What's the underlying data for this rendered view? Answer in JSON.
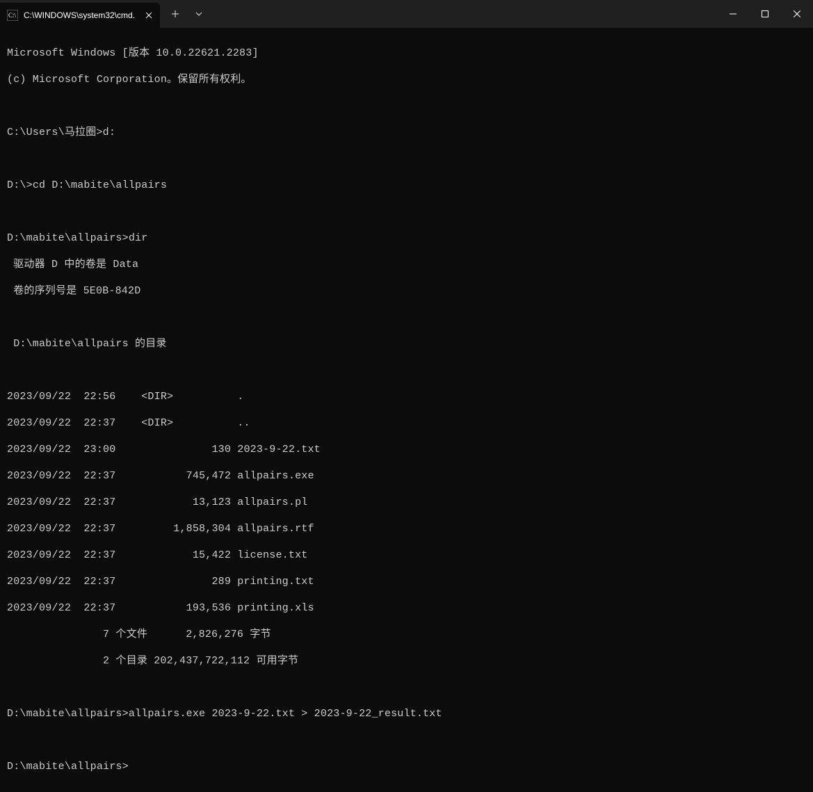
{
  "titlebar": {
    "tab_title": "C:\\WINDOWS\\system32\\cmd."
  },
  "terminal": {
    "header_line1": "Microsoft Windows [版本 10.0.22621.2283]",
    "header_line2": "(c) Microsoft Corporation。保留所有权利。",
    "prompt1": "C:\\Users\\马拉圈>",
    "cmd1": "d:",
    "prompt2": "D:\\>",
    "cmd2": "cd D:\\mabite\\allpairs",
    "prompt3": "D:\\mabite\\allpairs>",
    "cmd3": "dir",
    "dir_drive": " 驱动器 D 中的卷是 Data",
    "dir_serial": " 卷的序列号是 5E0B-842D",
    "dir_of": " D:\\mabite\\allpairs 的目录",
    "entries": [
      "2023/09/22  22:56    <DIR>          .",
      "2023/09/22  22:37    <DIR>          ..",
      "2023/09/22  23:00               130 2023-9-22.txt",
      "2023/09/22  22:37           745,472 allpairs.exe",
      "2023/09/22  22:37            13,123 allpairs.pl",
      "2023/09/22  22:37         1,858,304 allpairs.rtf",
      "2023/09/22  22:37            15,422 license.txt",
      "2023/09/22  22:37               289 printing.txt",
      "2023/09/22  22:37           193,536 printing.xls"
    ],
    "summary_files": "               7 个文件      2,826,276 字节",
    "summary_dirs": "               2 个目录 202,437,722,112 可用字节",
    "prompt4": "D:\\mabite\\allpairs>",
    "cmd4": "allpairs.exe 2023-9-22.txt > 2023-9-22_result.txt",
    "prompt5": "D:\\mabite\\allpairs>"
  }
}
